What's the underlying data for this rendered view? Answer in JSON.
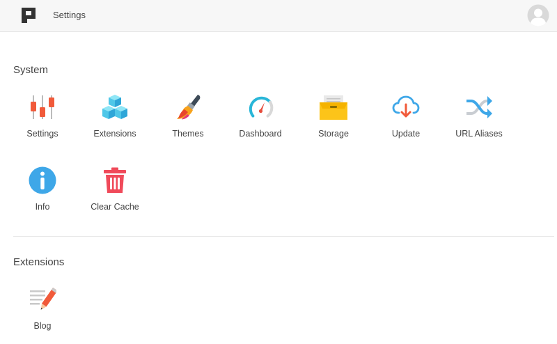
{
  "header": {
    "title": "Settings",
    "logo_icon": "app-logo-icon",
    "avatar_icon": "user-avatar-icon"
  },
  "sections": {
    "system": {
      "title": "System",
      "items": [
        {
          "label": "Settings",
          "icon": "sliders-icon"
        },
        {
          "label": "Extensions",
          "icon": "cubes-icon"
        },
        {
          "label": "Themes",
          "icon": "paintbrush-icon"
        },
        {
          "label": "Dashboard",
          "icon": "gauge-icon"
        },
        {
          "label": "Storage",
          "icon": "storage-box-icon"
        },
        {
          "label": "Update",
          "icon": "cloud-download-icon"
        },
        {
          "label": "URL Aliases",
          "icon": "shuffle-icon"
        },
        {
          "label": "Info",
          "icon": "info-icon"
        },
        {
          "label": "Clear Cache",
          "icon": "trash-icon"
        }
      ]
    },
    "extensions": {
      "title": "Extensions",
      "items": [
        {
          "label": "Blog",
          "icon": "blog-pencil-icon"
        }
      ]
    }
  },
  "colors": {
    "topbar": "#f7f7f7",
    "accent_blue": "#3ea7e8",
    "accent_red": "#f15a4a",
    "accent_yellow": "#fcc419"
  }
}
